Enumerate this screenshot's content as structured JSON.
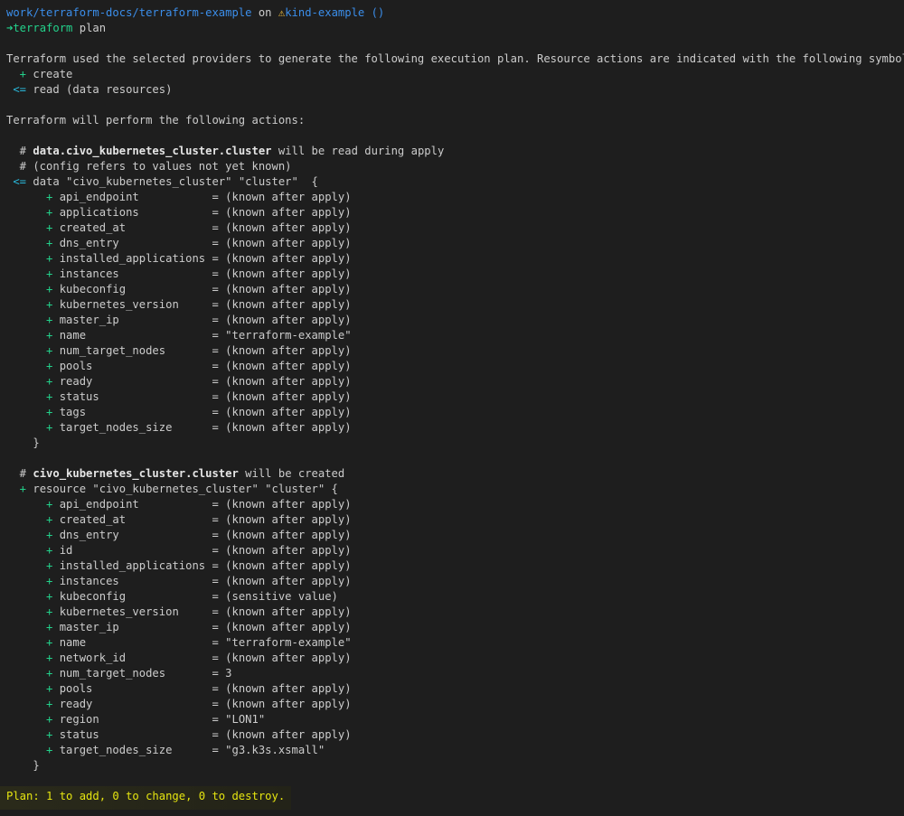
{
  "prompt": {
    "path": "work/terraform-docs/terraform-example",
    "on": " on ",
    "branch_icon": "warning-icon",
    "branch": "kind-example ()",
    "arrow": "➜",
    "command_prefix": "terraform",
    "command": " plan"
  },
  "intro": {
    "line1": "Terraform used the selected providers to generate the following execution plan. Resource actions are indicated with the following symbols:",
    "create_sym": "  + ",
    "create_label": "create",
    "read_sym": " <= ",
    "read_label": "read (data resources)",
    "perform": "Terraform will perform the following actions:"
  },
  "data_block": {
    "comment_prefix": "  # ",
    "comment_name": "data.civo_kubernetes_cluster.cluster",
    "comment_suffix": " will be read during apply",
    "comment2": "  # (config refers to values not yet known)",
    "decl_sym": " <= ",
    "decl": "data \"civo_kubernetes_cluster\" \"cluster\"  {",
    "attrs": [
      {
        "key": "api_endpoint",
        "value": "(known after apply)"
      },
      {
        "key": "applications",
        "value": "(known after apply)"
      },
      {
        "key": "created_at",
        "value": "(known after apply)"
      },
      {
        "key": "dns_entry",
        "value": "(known after apply)"
      },
      {
        "key": "installed_applications",
        "value": "(known after apply)"
      },
      {
        "key": "instances",
        "value": "(known after apply)"
      },
      {
        "key": "kubeconfig",
        "value": "(known after apply)"
      },
      {
        "key": "kubernetes_version",
        "value": "(known after apply)"
      },
      {
        "key": "master_ip",
        "value": "(known after apply)"
      },
      {
        "key": "name",
        "value": "\"terraform-example\""
      },
      {
        "key": "num_target_nodes",
        "value": "(known after apply)"
      },
      {
        "key": "pools",
        "value": "(known after apply)"
      },
      {
        "key": "ready",
        "value": "(known after apply)"
      },
      {
        "key": "status",
        "value": "(known after apply)"
      },
      {
        "key": "tags",
        "value": "(known after apply)"
      },
      {
        "key": "target_nodes_size",
        "value": "(known after apply)"
      }
    ],
    "close": "    }"
  },
  "resource_block": {
    "comment_prefix": "  # ",
    "comment_name": "civo_kubernetes_cluster.cluster",
    "comment_suffix": " will be created",
    "decl_sym": "  + ",
    "decl": "resource \"civo_kubernetes_cluster\" \"cluster\" {",
    "attrs": [
      {
        "key": "api_endpoint",
        "value": "(known after apply)"
      },
      {
        "key": "created_at",
        "value": "(known after apply)"
      },
      {
        "key": "dns_entry",
        "value": "(known after apply)"
      },
      {
        "key": "id",
        "value": "(known after apply)"
      },
      {
        "key": "installed_applications",
        "value": "(known after apply)"
      },
      {
        "key": "instances",
        "value": "(known after apply)"
      },
      {
        "key": "kubeconfig",
        "value": "(sensitive value)"
      },
      {
        "key": "kubernetes_version",
        "value": "(known after apply)"
      },
      {
        "key": "master_ip",
        "value": "(known after apply)"
      },
      {
        "key": "name",
        "value": "\"terraform-example\""
      },
      {
        "key": "network_id",
        "value": "(known after apply)"
      },
      {
        "key": "num_target_nodes",
        "value": "3"
      },
      {
        "key": "pools",
        "value": "(known after apply)"
      },
      {
        "key": "ready",
        "value": "(known after apply)"
      },
      {
        "key": "region",
        "value": "\"LON1\""
      },
      {
        "key": "status",
        "value": "(known after apply)"
      },
      {
        "key": "target_nodes_size",
        "value": "\"g3.k3s.xsmall\""
      }
    ],
    "close": "    }"
  },
  "summary": "Plan: 1 to add, 0 to change, 0 to destroy."
}
